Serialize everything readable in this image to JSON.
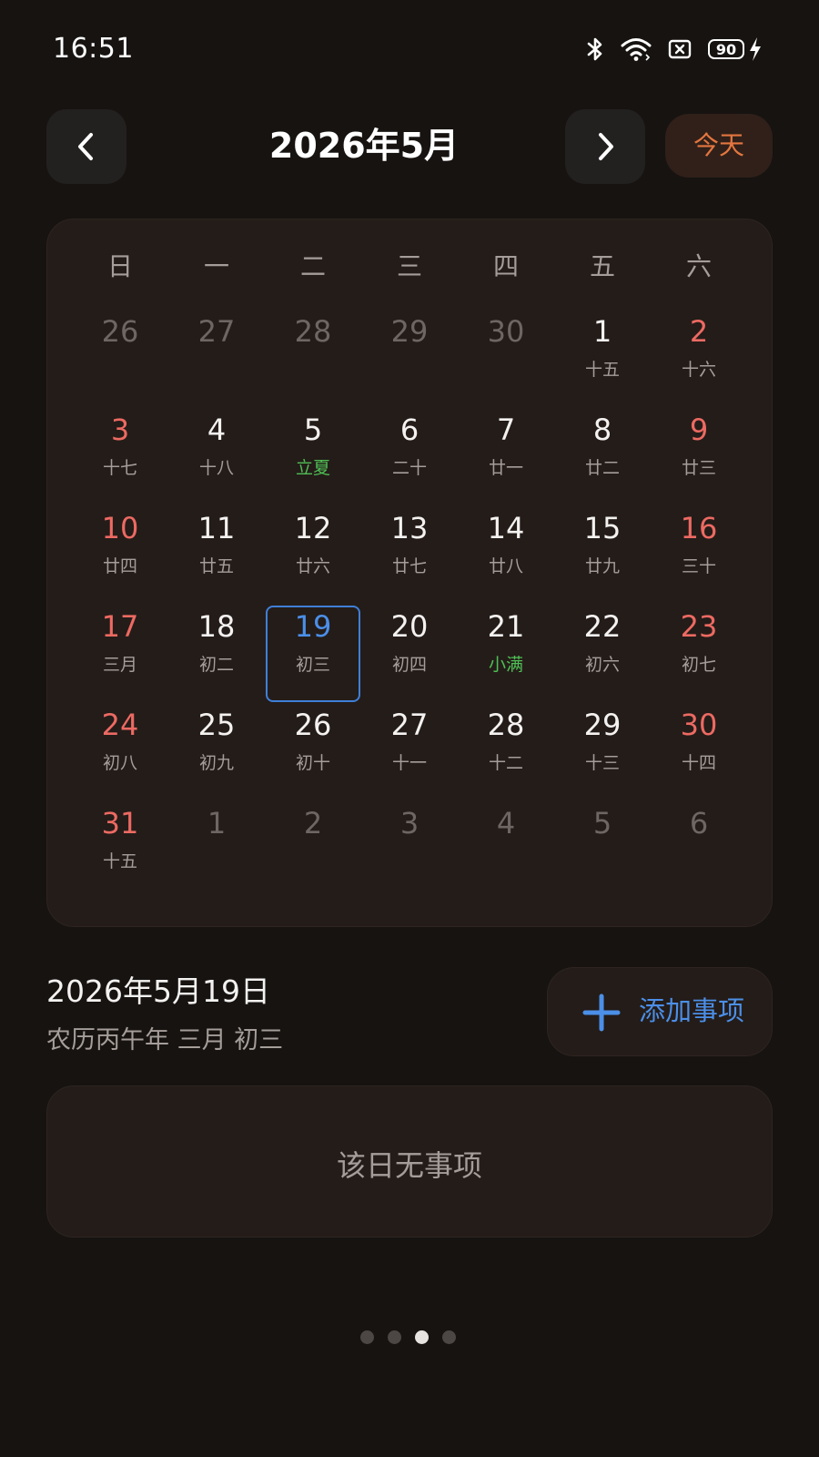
{
  "status_bar": {
    "time": "16:51",
    "battery_level": "90",
    "icons": [
      "bluetooth-icon",
      "wifi-icon",
      "no-sim-icon",
      "battery-icon",
      "charging-icon"
    ]
  },
  "header": {
    "month_title": "2026年5月",
    "today_label": "今天",
    "prev_icon": "chevron-left-icon",
    "next_icon": "chevron-right-icon"
  },
  "calendar": {
    "weekdays": [
      "日",
      "一",
      "二",
      "三",
      "四",
      "五",
      "六"
    ],
    "weeks": [
      [
        {
          "num": "26",
          "lunar": "",
          "type": "other"
        },
        {
          "num": "27",
          "lunar": "",
          "type": "other"
        },
        {
          "num": "28",
          "lunar": "",
          "type": "other"
        },
        {
          "num": "29",
          "lunar": "",
          "type": "other"
        },
        {
          "num": "30",
          "lunar": "",
          "type": "other"
        },
        {
          "num": "1",
          "lunar": "十五",
          "type": "normal"
        },
        {
          "num": "2",
          "lunar": "十六",
          "type": "weekend"
        }
      ],
      [
        {
          "num": "3",
          "lunar": "十七",
          "type": "weekend"
        },
        {
          "num": "4",
          "lunar": "十八",
          "type": "normal"
        },
        {
          "num": "5",
          "lunar": "立夏",
          "type": "term"
        },
        {
          "num": "6",
          "lunar": "二十",
          "type": "normal"
        },
        {
          "num": "7",
          "lunar": "廿一",
          "type": "normal"
        },
        {
          "num": "8",
          "lunar": "廿二",
          "type": "normal"
        },
        {
          "num": "9",
          "lunar": "廿三",
          "type": "weekend"
        }
      ],
      [
        {
          "num": "10",
          "lunar": "廿四",
          "type": "weekend"
        },
        {
          "num": "11",
          "lunar": "廿五",
          "type": "normal"
        },
        {
          "num": "12",
          "lunar": "廿六",
          "type": "normal"
        },
        {
          "num": "13",
          "lunar": "廿七",
          "type": "normal"
        },
        {
          "num": "14",
          "lunar": "廿八",
          "type": "normal"
        },
        {
          "num": "15",
          "lunar": "廿九",
          "type": "normal"
        },
        {
          "num": "16",
          "lunar": "三十",
          "type": "weekend"
        }
      ],
      [
        {
          "num": "17",
          "lunar": "三月",
          "type": "weekend"
        },
        {
          "num": "18",
          "lunar": "初二",
          "type": "normal"
        },
        {
          "num": "19",
          "lunar": "初三",
          "type": "selected"
        },
        {
          "num": "20",
          "lunar": "初四",
          "type": "normal"
        },
        {
          "num": "21",
          "lunar": "小满",
          "type": "term"
        },
        {
          "num": "22",
          "lunar": "初六",
          "type": "normal"
        },
        {
          "num": "23",
          "lunar": "初七",
          "type": "weekend"
        }
      ],
      [
        {
          "num": "24",
          "lunar": "初八",
          "type": "weekend"
        },
        {
          "num": "25",
          "lunar": "初九",
          "type": "normal"
        },
        {
          "num": "26",
          "lunar": "初十",
          "type": "normal"
        },
        {
          "num": "27",
          "lunar": "十一",
          "type": "normal"
        },
        {
          "num": "28",
          "lunar": "十二",
          "type": "normal"
        },
        {
          "num": "29",
          "lunar": "十三",
          "type": "normal"
        },
        {
          "num": "30",
          "lunar": "十四",
          "type": "weekend"
        }
      ],
      [
        {
          "num": "31",
          "lunar": "十五",
          "type": "weekend"
        },
        {
          "num": "1",
          "lunar": "",
          "type": "other"
        },
        {
          "num": "2",
          "lunar": "",
          "type": "other"
        },
        {
          "num": "3",
          "lunar": "",
          "type": "other"
        },
        {
          "num": "4",
          "lunar": "",
          "type": "other"
        },
        {
          "num": "5",
          "lunar": "",
          "type": "other"
        },
        {
          "num": "6",
          "lunar": "",
          "type": "other"
        }
      ]
    ]
  },
  "selected": {
    "date": "2026年5月19日",
    "lunar": "农历丙午年 三月 初三",
    "add_label": "添加事项",
    "add_icon": "plus-icon"
  },
  "events": {
    "empty_text": "该日无事项"
  },
  "pager": {
    "count": 4,
    "active_index": 2
  },
  "colors": {
    "background": "#161311",
    "card": "#241c19",
    "accent_orange": "#e3763f",
    "accent_blue": "#4b8fe8",
    "weekend_red": "#ec6a62",
    "solar_term_green": "#4fbf55",
    "muted_text": "#a59d99"
  }
}
